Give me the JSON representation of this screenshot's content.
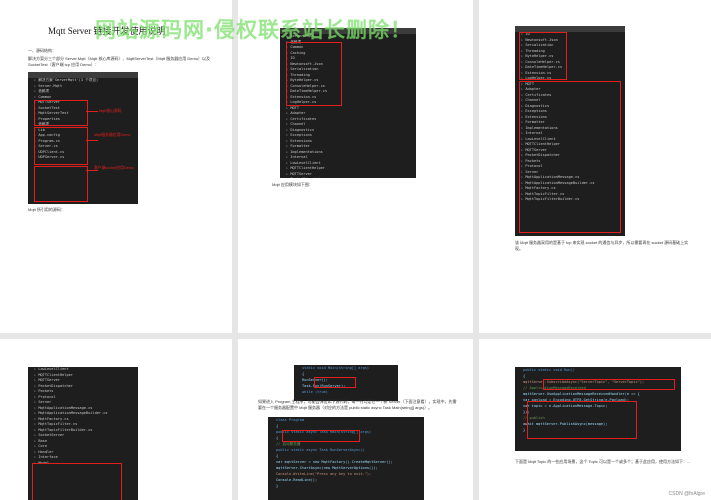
{
  "watermark": "网站源码网·侵权联系站长删除！",
  "doc": {
    "title": "Mqtt Server 链接开发使用说明",
    "p1_section": "一、源码结构：",
    "p1_text1": "解决方案分三个部分 Server.Mqtt（Mqtt 核心库源码）、MqttServerTest（Mqtt 服务器应用 Demo）以及 SocketTest（客户端 tcp 应用 Demo）：",
    "p1_caption": "Mqtt 所引用的源码：",
    "p2_caption": "Mqtt 应用模块如下图：",
    "p3_text": "该 Mqtt 服务器采用的是基于 tcp 来实现 socket 的通信与异步，所以需要再在 socket 源码基础上实现。",
    "p5_text": "如果进入 Program 主程序，可能会弹出如下源代码，每一行均是在一个新 Server（下面注意看），实现中，先需要在一个服务器配置中 Mqtt 服务器（对应的方法是 public static async Task Main(string[] args)）。",
    "p6_text": "下面是 Mqtt Topic 的一些应用场景，这个 Topic 可以是一个或多个；基于此应用，使用方法如下：...",
    "csdn": "CSDN @fnAlgre"
  },
  "labels": {
    "core": "Mqtt核心源码",
    "server_demo": "Mqtt服务器应用Demo",
    "client_demo": "客户端socket应用Demo"
  },
  "tree1": [
    "解决方案'ServerMqtt'(3 个项目)",
    "Server.Mqtt",
    "依赖项",
    "Common",
    "MQTTServer",
    "SocketTest",
    "MqttServerTest",
    "Properties",
    "依赖项",
    "Lib",
    "App.config",
    "Program.cs",
    "Server.cs",
    "UDPClient.cs",
    "UDPServer.cs"
  ],
  "tree2": [
    "Server.Mqtt",
    "依赖项",
    "Common",
    "Caching",
    "IO",
    "Newtonsoft.Json",
    "Serialization",
    "Threading",
    "ByteHelper.cs",
    "ConsoleHelper.cs",
    "DateTimeHelper.cs",
    "Extension.cs",
    "LogHelper.cs",
    "MQTT",
    "Adapter",
    "Certificates",
    "Channel",
    "Diagnostics",
    "Exceptions",
    "Extensions",
    "Formatter",
    "Implementations",
    "Internal",
    "LowLevelClient",
    "MQTTClientHelper",
    "MQTTServer",
    "PacketDispatcher"
  ],
  "tree3": [
    "IO",
    "Newtonsoft.Json",
    "Serialization",
    "Threading",
    "ByteHelper.cs",
    "ConsoleHelper.cs",
    "DateTimeHelper.cs",
    "Extension.cs",
    "LogHelper.cs",
    "MQTT",
    "Adapter",
    "Certificates",
    "Channel",
    "Diagnostics",
    "Exceptions",
    "Extensions",
    "Formatter",
    "Implementations",
    "Internal",
    "LowLevelClient",
    "MQTTClientHelper",
    "MQTTServer",
    "PacketDispatcher",
    "Packets",
    "Protocol",
    "Server",
    "MqttApplicationMessage.cs",
    "MqttApplicationMessageBuilder.cs",
    "MqttFactory.cs",
    "MqttTopicFilter.cs",
    "MqttTopicFilterBuilder.cs"
  ],
  "tree4": [
    "LowLevelClient",
    "MQTTClientHelper",
    "MQTTServer",
    "PacketDispatcher",
    "Packets",
    "Protocol",
    "Server",
    "MqttApplicationMessage.cs",
    "MqttApplicationMessageBuilder.cs",
    "MqttFactory.cs",
    "MqttTopicFilter.cs",
    "MqttTopicFilterBuilder.cs",
    "SocketServer",
    "Base",
    "Core",
    "Handler",
    "Interface",
    "Model"
  ],
  "code5a": [
    {
      "t": "static void Main(string[] args)",
      "c": "k"
    },
    {
      "t": "{",
      "c": ""
    },
    {
      "t": "    RunServer();",
      "c": ""
    },
    {
      "t": "    Task.Run(RunServer);",
      "c": ""
    },
    {
      "t": "    while (true)",
      "c": "k"
    }
  ],
  "code5b": [
    {
      "t": "class Program",
      "c": "k"
    },
    {
      "t": "{",
      "c": ""
    },
    {
      "t": "    public static async Task Main(string[] args)",
      "c": "k"
    },
    {
      "t": "    {",
      "c": ""
    },
    {
      "t": "    // 启动服务器",
      "c": "c"
    },
    {
      "t": "    public static async Task RunServerAsync()",
      "c": "k"
    },
    {
      "t": "    {",
      "c": ""
    },
    {
      "t": "        var mqttServer = new MqttFactory().CreateMqttServer();",
      "c": ""
    },
    {
      "t": "        mqttServer.StartAsync(new MqttServerOptions());",
      "c": ""
    },
    {
      "t": "        Console.WriteLine(\"Press any key to exit.\");",
      "c": "s"
    },
    {
      "t": "        Console.ReadLine();",
      "c": ""
    },
    {
      "t": "    }",
      "c": ""
    }
  ],
  "code6": [
    {
      "t": "public static void Run()",
      "c": "k"
    },
    {
      "t": "{",
      "c": ""
    },
    {
      "t": "    mqttServer.SubscribeAsync(\"ServerTopic\", \"ServerTopic\");",
      "c": "s"
    },
    {
      "t": "    // ApplicationMessageReceived",
      "c": "c"
    },
    {
      "t": "    mqttServer.UseApplicationMessageReceivedHandler(e => {",
      "c": ""
    },
    {
      "t": "        var payload = Encoding.UTF8.GetString(e.Payload);",
      "c": ""
    },
    {
      "t": "        var topic = e.ApplicationMessage.Topic;",
      "c": ""
    },
    {
      "t": "    });",
      "c": ""
    },
    {
      "t": "    // publish",
      "c": "c"
    },
    {
      "t": "    await mqttServer.PublishAsync(message);",
      "c": ""
    },
    {
      "t": "}",
      "c": ""
    }
  ]
}
